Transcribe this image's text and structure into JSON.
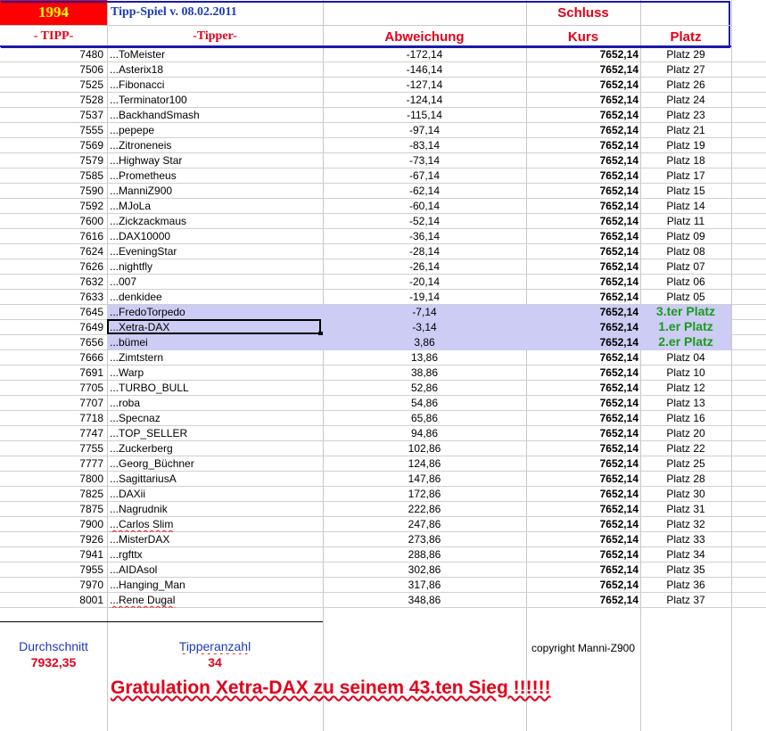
{
  "header": {
    "year": "1994",
    "title": "Tipp-Spiel v. 08.02.2011",
    "schluss": "Schluss",
    "col_tipp": "- TIPP-",
    "col_tipper": "-Tipper-",
    "col_abweichung": "Abweichung",
    "col_kurs": "Kurs",
    "col_platz": "Platz"
  },
  "colors": {
    "year_bg": "#ff0000",
    "year_fg": "#ffff00",
    "header_border": "#1a1aa8",
    "winner_bg": "#ccccf4",
    "winner_text": "#1a9a1a",
    "blue_text": "#1d3bbf",
    "red_text": "#e2001a"
  },
  "rows": [
    {
      "tipp": "7480",
      "tipper": "...ToMeister",
      "abw": "-172,14",
      "kurs": "7652,14",
      "platz": "Platz 29"
    },
    {
      "tipp": "7506",
      "tipper": "...Asterix18",
      "abw": "-146,14",
      "kurs": "7652,14",
      "platz": "Platz 27"
    },
    {
      "tipp": "7525",
      "tipper": "...Fibonacci",
      "abw": "-127,14",
      "kurs": "7652,14",
      "platz": "Platz 26"
    },
    {
      "tipp": "7528",
      "tipper": "...Terminator100",
      "abw": "-124,14",
      "kurs": "7652,14",
      "platz": "Platz 24"
    },
    {
      "tipp": "7537",
      "tipper": "...BackhandSmash",
      "abw": "-115,14",
      "kurs": "7652,14",
      "platz": "Platz 23"
    },
    {
      "tipp": "7555",
      "tipper": "...pepepe",
      "abw": "-97,14",
      "kurs": "7652,14",
      "platz": "Platz 21"
    },
    {
      "tipp": "7569",
      "tipper": "...Zitroneneis",
      "abw": "-83,14",
      "kurs": "7652,14",
      "platz": "Platz 19"
    },
    {
      "tipp": "7579",
      "tipper": "...Highway Star",
      "abw": "-73,14",
      "kurs": "7652,14",
      "platz": "Platz 18"
    },
    {
      "tipp": "7585",
      "tipper": "...Prometheus",
      "abw": "-67,14",
      "kurs": "7652,14",
      "platz": "Platz 17"
    },
    {
      "tipp": "7590",
      "tipper": "...ManniZ900",
      "abw": "-62,14",
      "kurs": "7652,14",
      "platz": "Platz 15"
    },
    {
      "tipp": "7592",
      "tipper": "...MJoLa",
      "abw": "-60,14",
      "kurs": "7652,14",
      "platz": "Platz 14"
    },
    {
      "tipp": "7600",
      "tipper": "...Zickzackmaus",
      "abw": "-52,14",
      "kurs": "7652,14",
      "platz": "Platz 11"
    },
    {
      "tipp": "7616",
      "tipper": "...DAX10000",
      "abw": "-36,14",
      "kurs": "7652,14",
      "platz": "Platz 09"
    },
    {
      "tipp": "7624",
      "tipper": "...EveningStar",
      "abw": "-28,14",
      "kurs": "7652,14",
      "platz": "Platz 08"
    },
    {
      "tipp": "7626",
      "tipper": "...nightfly",
      "abw": "-26,14",
      "kurs": "7652,14",
      "platz": "Platz 07"
    },
    {
      "tipp": "7632",
      "tipper": "...007",
      "abw": "-20,14",
      "kurs": "7652,14",
      "platz": "Platz 06"
    },
    {
      "tipp": "7633",
      "tipper": "...denkidee",
      "abw": "-19,14",
      "kurs": "7652,14",
      "platz": "Platz 05"
    },
    {
      "tipp": "7645",
      "tipper": "...FredoTorpedo",
      "abw": "-7,14",
      "kurs": "7652,14",
      "platz": "3.ter Platz",
      "winner": true
    },
    {
      "tipp": "7649",
      "tipper": "...Xetra-DAX",
      "abw": "-3,14",
      "kurs": "7652,14",
      "platz": "1.er Platz",
      "winner": true,
      "selected": true
    },
    {
      "tipp": "7656",
      "tipper": "...bümei",
      "abw": "3,86",
      "kurs": "7652,14",
      "platz": "2.er Platz",
      "winner": true
    },
    {
      "tipp": "7666",
      "tipper": "...Zimtstern",
      "abw": "13,86",
      "kurs": "7652,14",
      "platz": "Platz 04"
    },
    {
      "tipp": "7691",
      "tipper": "...Warp",
      "abw": "38,86",
      "kurs": "7652,14",
      "platz": "Platz 10"
    },
    {
      "tipp": "7705",
      "tipper": "...TURBO_BULL",
      "abw": "52,86",
      "kurs": "7652,14",
      "platz": "Platz 12"
    },
    {
      "tipp": "7707",
      "tipper": "...roba",
      "abw": "54,86",
      "kurs": "7652,14",
      "platz": "Platz 13"
    },
    {
      "tipp": "7718",
      "tipper": "...Specnaz",
      "abw": "65,86",
      "kurs": "7652,14",
      "platz": "Platz 16"
    },
    {
      "tipp": "7747",
      "tipper": "...TOP_SELLER",
      "abw": "94,86",
      "kurs": "7652,14",
      "platz": "Platz 20"
    },
    {
      "tipp": "7755",
      "tipper": "...Zuckerberg",
      "abw": "102,86",
      "kurs": "7652,14",
      "platz": "Platz 22"
    },
    {
      "tipp": "7777",
      "tipper": "...Georg_Büchner",
      "abw": "124,86",
      "kurs": "7652,14",
      "platz": "Platz 25"
    },
    {
      "tipp": "7800",
      "tipper": "...SagittariusA",
      "abw": "147,86",
      "kurs": "7652,14",
      "platz": "Platz 28"
    },
    {
      "tipp": "7825",
      "tipper": "...DAXii",
      "abw": "172,86",
      "kurs": "7652,14",
      "platz": "Platz 30"
    },
    {
      "tipp": "7875",
      "tipper": "...Nagrudnik",
      "abw": "222,86",
      "kurs": "7652,14",
      "platz": "Platz 31"
    },
    {
      "tipp": "7900",
      "tipper": "...Carlos Slim",
      "abw": "247,86",
      "kurs": "7652,14",
      "platz": "Platz 32"
    },
    {
      "tipp": "7926",
      "tipper": "...MisterDAX",
      "abw": "273,86",
      "kurs": "7652,14",
      "platz": "Platz 33"
    },
    {
      "tipp": "7941",
      "tipper": "...rgfttx",
      "abw": "288,86",
      "kurs": "7652,14",
      "platz": "Platz 34"
    },
    {
      "tipp": "7955",
      "tipper": "...AIDAsol",
      "abw": "302,86",
      "kurs": "7652,14",
      "platz": "Platz 35"
    },
    {
      "tipp": "7970",
      "tipper": "...Hanging_Man",
      "abw": "317,86",
      "kurs": "7652,14",
      "platz": "Platz 36"
    },
    {
      "tipp": "8001",
      "tipper": "...Rene Dugal",
      "abw": "348,86",
      "kurs": "7652,14",
      "platz": "Platz 37"
    }
  ],
  "footer": {
    "durchschnitt_label": "Durchschnitt",
    "durchschnitt_value": "7932,35",
    "tipperanzahl_label": "Tipperanzahl",
    "tipperanzahl_value": "34",
    "copyright": "copyright Manni-Z900",
    "gratulation": "Gratulation  Xetra-DAX  zu seinem 43.ten Sieg !!!!!!"
  }
}
